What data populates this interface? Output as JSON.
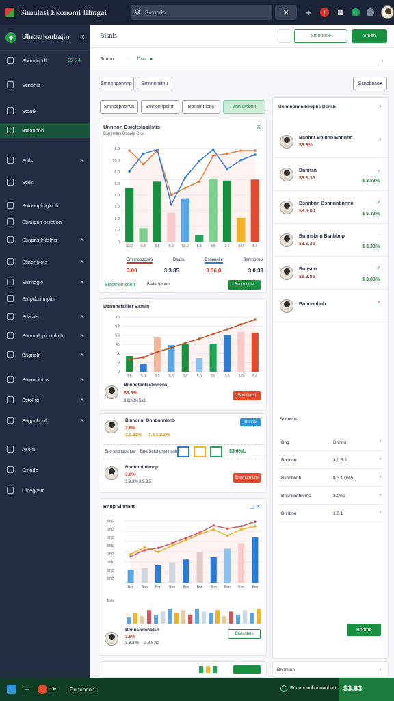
{
  "app": {
    "title": "Simulasi Ekonomi Illmgai",
    "search_placeholder": "Smuorio"
  },
  "sidebar": {
    "title": "Ulnganoubajin",
    "close": "X",
    "items": [
      {
        "label": "Sbonnoudl",
        "badge": "$5 5 4"
      },
      {
        "label": "Stinonle"
      },
      {
        "label": "Stomk"
      },
      {
        "label": "Bteonnnh"
      },
      {
        "label": "Stitls"
      },
      {
        "label": "Stids"
      },
      {
        "label": "Snlonnpioiglnoh"
      },
      {
        "label": "Sbmipnn otsetion"
      },
      {
        "label": "Sbnpnstlnilslhis"
      },
      {
        "label": "Stinonpiots"
      },
      {
        "label": "Shimdgio"
      },
      {
        "label": "Srupdonnnpitlr"
      },
      {
        "label": "Stlatals"
      },
      {
        "label": "Snnnudnpibnnlnth"
      },
      {
        "label": "Bngnoln"
      },
      {
        "label": "Sntonniotos"
      },
      {
        "label": "Stitolng"
      },
      {
        "label": "Bngpnbnnln"
      },
      {
        "label": "Asom"
      },
      {
        "label": "Smade"
      },
      {
        "label": "Dinegnstr"
      }
    ]
  },
  "header": {
    "title": "Bisnis",
    "btn_outline": "Smonone",
    "btn_green": "Smeh"
  },
  "subheader": {
    "left": "Smnm",
    "mid": "Dsn"
  },
  "filters": {
    "a": "Smnonponnnp",
    "b": "Smnnnniitnu",
    "right": "Ssnobnso"
  },
  "tabs": [
    "Smnbspnbnus",
    "Bmnonnpsinn",
    "Bonnlnnions",
    "Bnn Dnbnn"
  ],
  "card1": {
    "title": "Unnnon Dsieltslnsilstis",
    "subtitle": "Bsmnnlns Dsnole Dzsi",
    "close": "X",
    "legend": [
      "Bmnnoodoses",
      "Bsubs",
      "Bsnnoaite",
      "Bsmnonsls"
    ],
    "values": [
      "3.00",
      "3.3.85",
      "3.36.0",
      "3.0.33"
    ],
    "footer_label": "Blnotnoinsoon",
    "footer_sep": "Bsde Spnnn",
    "btn": "Bsooonnie"
  },
  "card2": {
    "title": "Dsnnnstsiilst Bsmln",
    "person": "Bnnnotontssbnnons",
    "value": "$3.8%",
    "sub": "3.Cn3%Ss3",
    "btn": "Bnd Bnod"
  },
  "card3": {
    "p1_name": "Bmnonnr Dnnbnnnlnnb",
    "p1_v1": "3.8%",
    "p1_v2": "3.0.33%",
    "p1_v3": "3.3.1.2.3%",
    "badge": "Bnnno",
    "mid_left": "Bno snbnsosnos",
    "mid_mid": "Bnd Smondnsnnsnh",
    "mid_value": "$3.6%L",
    "p2_name": "Bnnbnnlnlbnnp",
    "p2_v1": "3.8%",
    "p2_v2": "3.9.3%",
    "p2_v3": "3.9.3.5",
    "btn": "Bnnmonnbno"
  },
  "card4": {
    "title": "Bnnp Slnnnnt",
    "ylabels": [
      "5N2",
      "3N3",
      "3N3",
      "5N0",
      "3N3",
      "3N0",
      "5N3",
      "5N3"
    ],
    "lower_label": "Bsls",
    "person_name": "Bnnnsnnnnotsn",
    "v1": "3.8%",
    "v2": "3.8.3.%",
    "v3": "3.3.8.40",
    "btn": "Bnnsnbns"
  },
  "right_panel": {
    "title": "Uonnnonnnlblnrpbs Dsnsb",
    "people": [
      {
        "name": "Banhnt Bninnn Bnnnhn",
        "sub": "$3.8%",
        "delta": "",
        "trend": "up",
        "icon": "chevron"
      },
      {
        "name": "Bnnnsn",
        "sub": "$3.8.36",
        "delta": "$ 3.83%",
        "trend": "down",
        "icon": "chevron-red"
      },
      {
        "name": "Bsnnbnn Bsnnnnbnnnn",
        "sub": "$3.5.80",
        "delta": "$ 5.33%",
        "trend": "up",
        "icon": "check"
      },
      {
        "name": "Bnnnsbnn Bsnbbnp",
        "sub": "$3.5.35",
        "delta": "$ 3.33%",
        "trend": "up",
        "icon": "dash"
      },
      {
        "name": "Bnnsnn",
        "sub": "$3.3.85",
        "delta": "$ 3.83%",
        "trend": "up",
        "icon": "check"
      },
      {
        "name": "Bnnonnbnb",
        "sub": "",
        "delta": "",
        "trend": "down",
        "icon": "chevron-red"
      }
    ],
    "section2_title": "Bnnnnns",
    "table_rows": [
      {
        "k": "Bng",
        "v": "Dnnno"
      },
      {
        "k": "Bnonnb",
        "v": "3.0.5.3"
      },
      {
        "k": "Bsnnbnnb",
        "v": "8.3.1.0%5"
      },
      {
        "k": "Bnsnnnnbnnno",
        "v": "3.0%3"
      },
      {
        "k": "Bnnbnn",
        "v": "3.0.1"
      }
    ],
    "btn": "Bnnms",
    "bottom": "Bnnnnnn"
  },
  "footer": {
    "label": "Bnnnnnnn",
    "right_label": "Bnnnnnnnbnnnoobnn",
    "right_value": "$3.83"
  },
  "chart_data": [
    {
      "type": "bar",
      "title": "Unnnon Dsieltslnsilstis",
      "categories": [
        "$3.0",
        "5.5",
        "5.5",
        "5.0",
        "$3.0",
        "5.5",
        "5.5",
        "3.0",
        "5.0",
        "5.0"
      ],
      "ylim": [
        0,
        9
      ],
      "ylabels": [
        "8.0",
        "70.0",
        "6.0",
        "5.0",
        "4.0",
        "3.0",
        "2.0",
        "1.0",
        "0"
      ],
      "series": [
        {
          "values": [
            5.2,
            1.3,
            5.8,
            2.8,
            4.2,
            0.6,
            6.1,
            5.9,
            2.3,
            6.0
          ]
        },
        {
          "values": [
            8.8,
            7.5,
            8.8,
            4.5,
            5.2,
            5.8,
            8.3,
            8.5,
            8.8,
            8.8
          ]
        },
        {
          "values": [
            6.8,
            8.5,
            8.9,
            3.6,
            6.2,
            7.8,
            8.9,
            7.0,
            7.9,
            8.4
          ]
        }
      ]
    },
    {
      "type": "bar",
      "title": "Dsnnnstsiilst Bsmln",
      "categories": [
        "3.5",
        "5.0",
        "5.0",
        "5.5",
        "3.0",
        "5.0",
        "3.0",
        "3.0",
        "5.0",
        "5.0"
      ],
      "ylim": [
        0,
        8
      ],
      "ylabels": [
        "70",
        "6B",
        "5B",
        "45",
        "7B",
        "1B",
        "0"
      ],
      "series": [
        {
          "values": [
            2.3,
            1.2,
            5.0,
            3.9,
            4.1,
            2.0,
            4.1,
            5.3,
            5.8,
            5.7
          ]
        },
        {
          "values": [
            1.8,
            2.1,
            2.9,
            3.5,
            4.2,
            4.8,
            5.5,
            6.2,
            6.9,
            7.6
          ]
        }
      ]
    },
    {
      "type": "bar",
      "title": "Bnnp Slnnnnt",
      "categories": [
        "Bsn",
        "Bnn",
        "Bnn",
        "Bnn",
        "Bnn",
        "Bnn",
        "Bnn",
        "Bnn",
        "Bnn",
        "Bnn"
      ],
      "ylim": [
        0,
        8
      ],
      "series": [
        {
          "values": [
            1.7,
            1.9,
            2.3,
            2.6,
            3.0,
            4.0,
            3.3,
            4.4,
            5.1,
            5.9
          ]
        },
        {
          "values": [
            3.7,
            4.6,
            4.0,
            4.8,
            5.5,
            6.3,
            6.9,
            6.1,
            6.9,
            7.3
          ]
        },
        {
          "values": [
            3.4,
            4.2,
            4.5,
            5.1,
            5.8,
            6.5,
            7.4,
            7.0,
            7.3,
            7.9
          ]
        }
      ]
    }
  ]
}
